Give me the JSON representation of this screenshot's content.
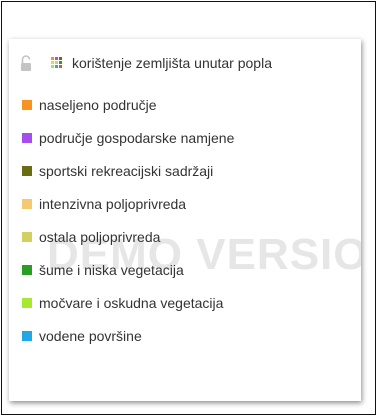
{
  "legend": {
    "watermark": "DEMO VERSION",
    "layer": {
      "lock_icon": "unlocked-padlock-icon",
      "layer_icon": "multicolor-grid-icon",
      "label": "korištenje zemljišta unutar popla"
    },
    "items": [
      {
        "label": "naseljeno područje",
        "color": "#f7931e"
      },
      {
        "label": "područje gospodarske namjene",
        "color": "#a64ded"
      },
      {
        "label": "sportski rekreacijski sadržaji",
        "color": "#6b6b10"
      },
      {
        "label": "intenzivna poljoprivreda",
        "color": "#f4c96f"
      },
      {
        "label": "ostala poljoprivreda",
        "color": "#d2d05e"
      },
      {
        "label": " šume i niska vegetacija",
        "color": "#2a9e24"
      },
      {
        "label": "močvare i oskudna vegetacija",
        "color": "#a8e82e"
      },
      {
        "label": "vodene površine",
        "color": "#21a7e6"
      }
    ],
    "grid_colors": [
      "#f7931e",
      "#a64ded",
      "#6b6b10",
      "#f4c96f",
      "#d2d05e",
      "#2a9e24",
      "#a8e82e",
      "#21a7e6",
      "#e8503a"
    ]
  }
}
